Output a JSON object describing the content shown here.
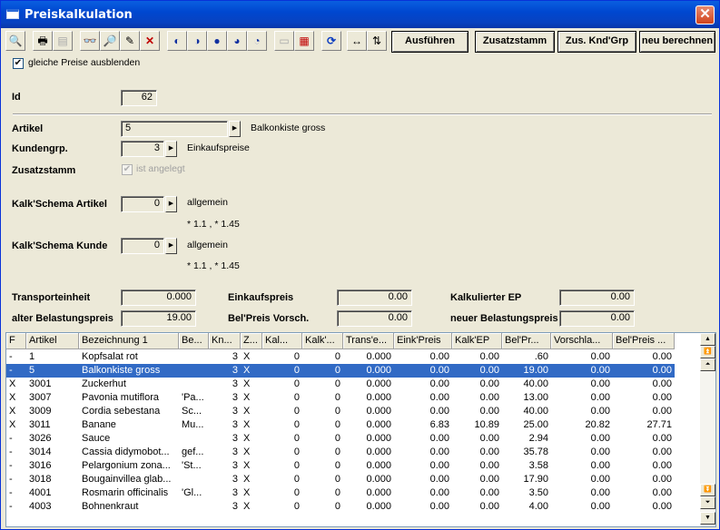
{
  "window": {
    "title": "Preiskalkulation",
    "close_glyph": "✕"
  },
  "toolbar": {
    "icons": [
      {
        "name": "search-icon",
        "glyph": "🔍"
      },
      {
        "name": "print-icon",
        "glyph": "🖶"
      },
      {
        "name": "print-preview-icon",
        "glyph": "▤"
      },
      {
        "name": "binoculars-icon",
        "glyph": "👓"
      },
      {
        "name": "find-next-icon",
        "glyph": "🔎"
      },
      {
        "name": "edit-icon",
        "glyph": "✎"
      },
      {
        "name": "delete-icon",
        "glyph": "✕"
      },
      {
        "name": "sort-1-icon",
        "glyph": "◐"
      },
      {
        "name": "sort-2-icon",
        "glyph": "◑"
      },
      {
        "name": "sort-3-icon",
        "glyph": "●"
      },
      {
        "name": "sort-4-icon",
        "glyph": "◕"
      },
      {
        "name": "sort-5-icon",
        "glyph": "◔"
      },
      {
        "name": "new-record-icon",
        "glyph": "▭"
      },
      {
        "name": "delete-record-icon",
        "glyph": "▦"
      },
      {
        "name": "refresh-icon",
        "glyph": "⟳"
      },
      {
        "name": "fit-width-icon",
        "glyph": "↔"
      },
      {
        "name": "grid-settings-icon",
        "glyph": "⇅"
      }
    ],
    "buttons": {
      "execute": "Ausführen",
      "zusatzstamm": "Zusatzstamm",
      "zus_knd_grp": "Zus. Knd'Grp",
      "recalc": "neu berechnen"
    }
  },
  "form": {
    "hide_same_prices": {
      "label": "gleiche Preise ausblenden",
      "checked": true
    },
    "id": {
      "label": "Id",
      "value": "62"
    },
    "artikel": {
      "label": "Artikel",
      "value": "5",
      "description": "Balkonkiste gross"
    },
    "kundengrp": {
      "label": "Kundengrp.",
      "value": "3",
      "description": "Einkaufspreise"
    },
    "zusatzstamm": {
      "label": "Zusatzstamm",
      "checkbox_label": "ist angelegt",
      "checked": true
    },
    "kalk_artikel": {
      "label": "Kalk'Schema Artikel",
      "value": "0",
      "description": "allgemein",
      "formula": "* 1.1 , * 1.45"
    },
    "kalk_kunde": {
      "label": "Kalk'Schema Kunde",
      "value": "0",
      "description": "allgemein",
      "formula": "* 1.1 , * 1.45"
    },
    "transporteinheit": {
      "label": "Transporteinheit",
      "value": "0.000"
    },
    "alter_bp": {
      "label": "alter Belastungspreis",
      "value": "19.00"
    },
    "einkaufspreis": {
      "label": "Einkaufspreis",
      "value": "0.00"
    },
    "belpreis_vorsch": {
      "label": "Bel'Preis Vorsch.",
      "value": "0.00"
    },
    "kalk_ep": {
      "label": "Kalkulierter EP",
      "value": "0.00"
    },
    "neuer_bp": {
      "label": "neuer Belastungspreis",
      "value": "0.00"
    }
  },
  "grid": {
    "headers": [
      "F",
      "Artikel",
      "Bezeichnung 1",
      "Be...",
      "Kn...",
      "Z...",
      "Kal...",
      "Kalk'...",
      "Trans'e...",
      "Eink'Preis",
      "Kalk'EP",
      "Bel'Pr...",
      "Vorschla...",
      "Bel'Preis ..."
    ],
    "selected_index": 1,
    "rows": [
      [
        "-",
        "1",
        "Kopfsalat rot",
        "",
        "3",
        "X",
        "0",
        "0",
        "0.000",
        "0.00",
        "0.00",
        ".60",
        "0.00",
        "0.00"
      ],
      [
        "-",
        "5",
        "Balkonkiste gross",
        "",
        "3",
        "X",
        "0",
        "0",
        "0.000",
        "0.00",
        "0.00",
        "19.00",
        "0.00",
        "0.00"
      ],
      [
        "X",
        "3001",
        "Zuckerhut",
        "",
        "3",
        "X",
        "0",
        "0",
        "0.000",
        "0.00",
        "0.00",
        "40.00",
        "0.00",
        "0.00"
      ],
      [
        "X",
        "3007",
        "Pavonia mutiflora",
        "'Pa...",
        "3",
        "X",
        "0",
        "0",
        "0.000",
        "0.00",
        "0.00",
        "13.00",
        "0.00",
        "0.00"
      ],
      [
        "X",
        "3009",
        "Cordia sebestana",
        "Sc...",
        "3",
        "X",
        "0",
        "0",
        "0.000",
        "0.00",
        "0.00",
        "40.00",
        "0.00",
        "0.00"
      ],
      [
        "X",
        "3011",
        "Banane",
        "Mu...",
        "3",
        "X",
        "0",
        "0",
        "0.000",
        "6.83",
        "10.89",
        "25.00",
        "20.82",
        "27.71"
      ],
      [
        "-",
        "3026",
        "Sauce",
        "",
        "3",
        "X",
        "0",
        "0",
        "0.000",
        "0.00",
        "0.00",
        "2.94",
        "0.00",
        "0.00"
      ],
      [
        "-",
        "3014",
        "Cassia didymobot...",
        "gef...",
        "3",
        "X",
        "0",
        "0",
        "0.000",
        "0.00",
        "0.00",
        "35.78",
        "0.00",
        "0.00"
      ],
      [
        "-",
        "3016",
        "Pelargonium zona...",
        "'St...",
        "3",
        "X",
        "0",
        "0",
        "0.000",
        "0.00",
        "0.00",
        "3.58",
        "0.00",
        "0.00"
      ],
      [
        "-",
        "3018",
        "Bougainvillea glab...",
        "",
        "3",
        "X",
        "0",
        "0",
        "0.000",
        "0.00",
        "0.00",
        "17.90",
        "0.00",
        "0.00"
      ],
      [
        "-",
        "4001",
        "Rosmarin officinalis",
        "'Gl...",
        "3",
        "X",
        "0",
        "0",
        "0.000",
        "0.00",
        "0.00",
        "3.50",
        "0.00",
        "0.00"
      ],
      [
        "-",
        "4003",
        "Bohnenkraut",
        "",
        "3",
        "X",
        "0",
        "0",
        "0.000",
        "0.00",
        "0.00",
        "4.00",
        "0.00",
        "0.00"
      ]
    ]
  }
}
